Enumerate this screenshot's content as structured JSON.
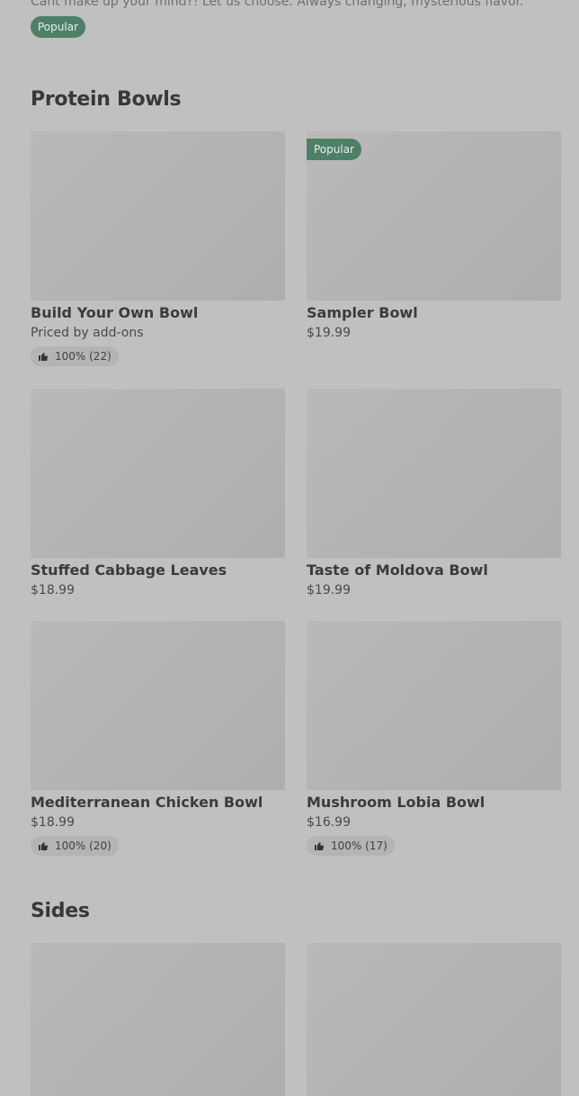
{
  "top": {
    "description": "Cant make up your mind?! Let us choose. Always changing, mysterious flavor.",
    "badge": "Popular"
  },
  "sections": {
    "protein_bowls": {
      "title": "Protein Bowls",
      "items": [
        {
          "name": "Build Your Own Bowl",
          "price": "Priced by add-ons",
          "rating": "100% (22)"
        },
        {
          "name": "Sampler Bowl",
          "price": "$19.99",
          "badge": "Popular"
        },
        {
          "name": "Stuffed Cabbage Leaves",
          "price": "$18.99"
        },
        {
          "name": "Taste of Moldova Bowl",
          "price": "$19.99"
        },
        {
          "name": "Mediterranean Chicken Bowl",
          "price": "$18.99",
          "rating": "100% (20)"
        },
        {
          "name": "Mushroom Lobia Bowl",
          "price": "$16.99",
          "rating": "100% (17)"
        }
      ]
    },
    "sides": {
      "title": "Sides"
    }
  },
  "icons": {
    "rating": "thumbs-up-icon"
  }
}
